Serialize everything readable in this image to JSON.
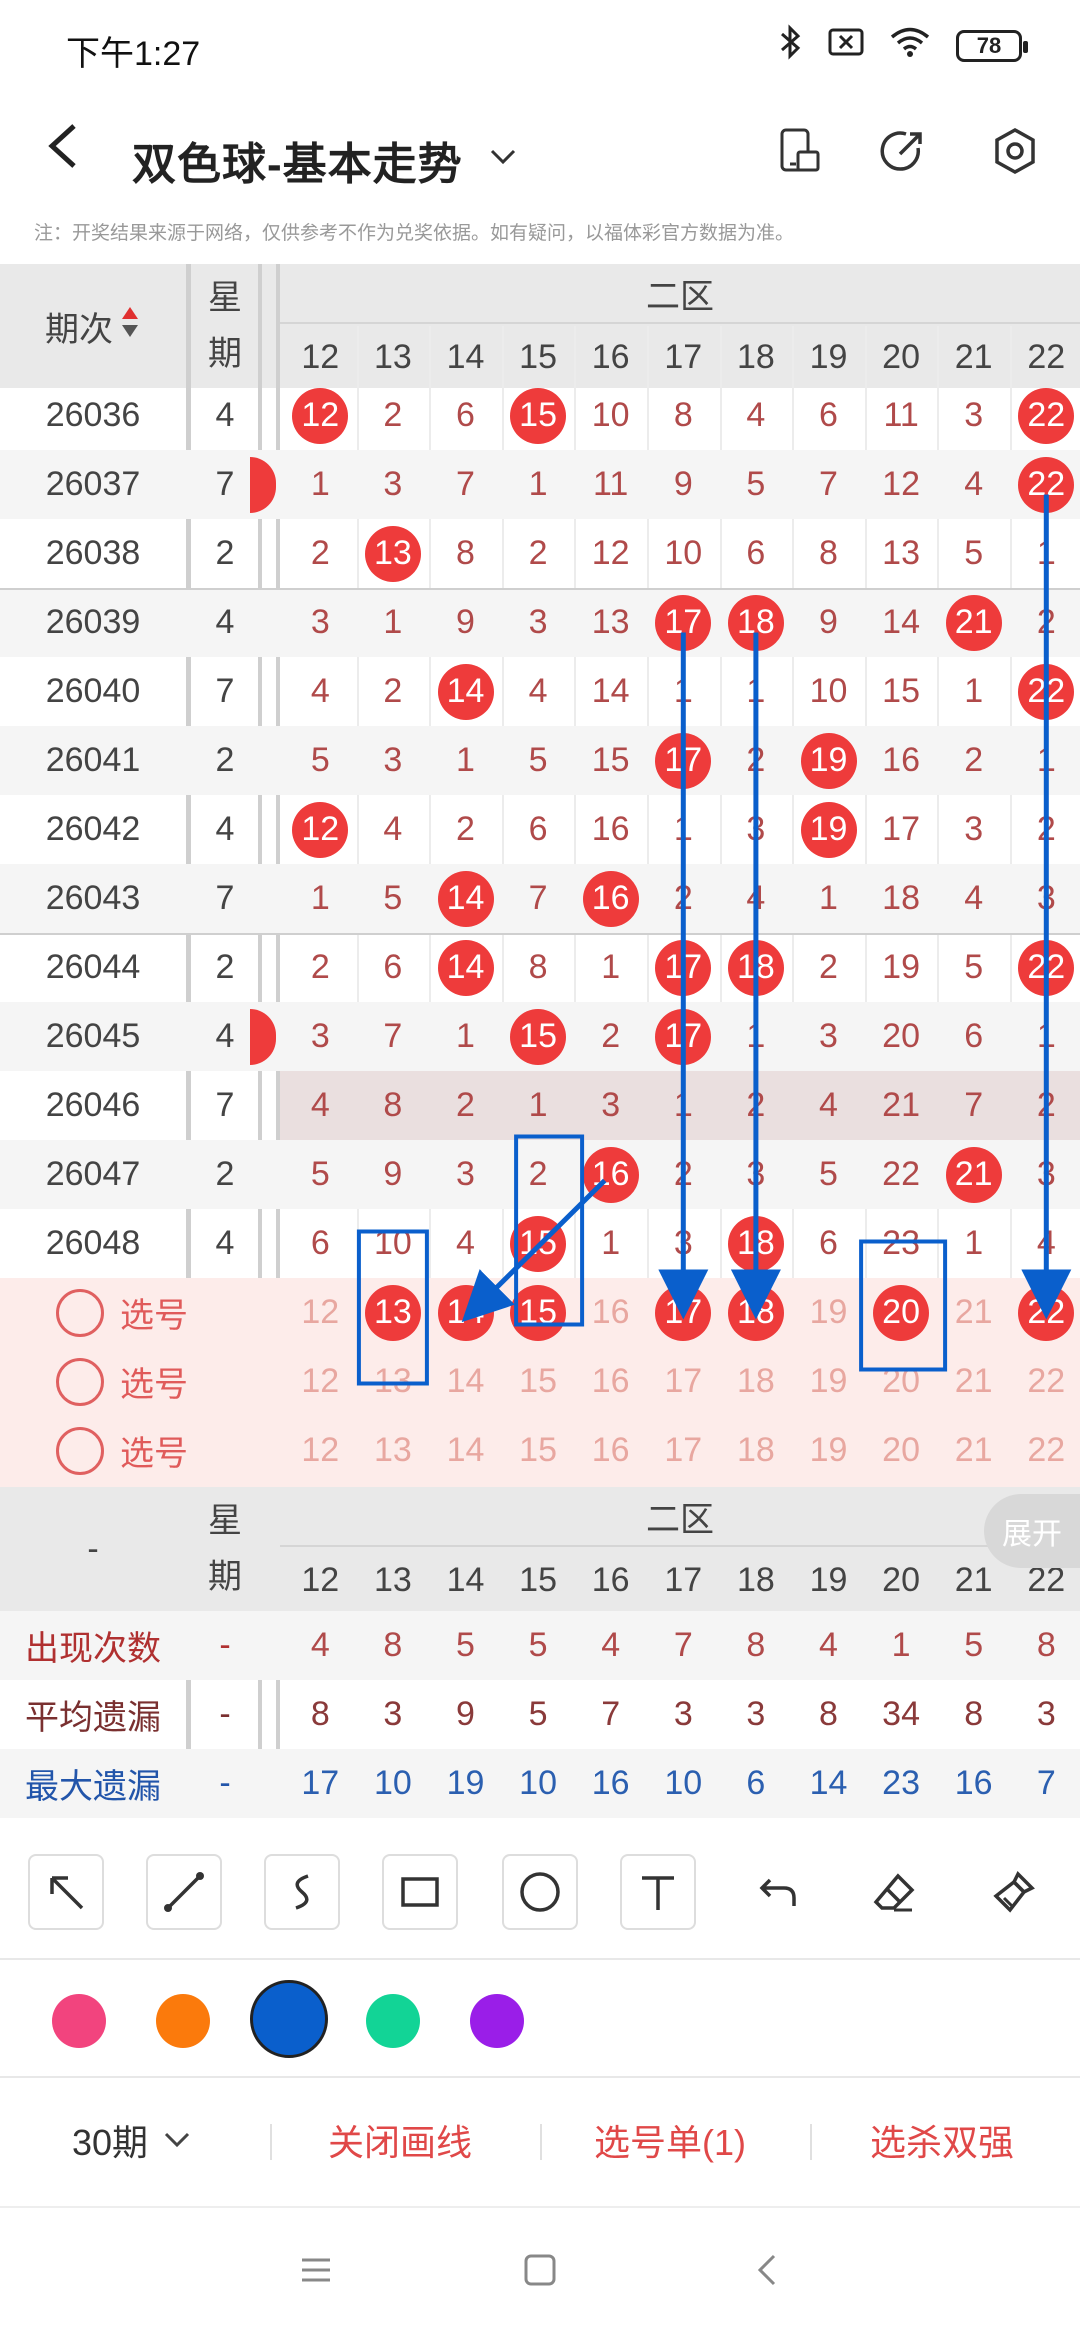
{
  "status": {
    "time": "下午1:27",
    "battery": "78"
  },
  "nav": {
    "title": "双色球-基本走势",
    "back_icon": "chevron-left-icon",
    "drop_icon": "chevron-down-icon"
  },
  "notice": "注：开奖结果来源于网络，仅供参考不作为兑奖依据。如有疑问，以福体彩官方数据为准。",
  "table": {
    "issue_header": "期次",
    "week_header": "星期",
    "zone_label": "二区",
    "columns": [
      "12",
      "13",
      "14",
      "15",
      "16",
      "17",
      "18",
      "19",
      "20",
      "21",
      "22"
    ],
    "rows": [
      {
        "issue": "26036",
        "week": "4",
        "cells": [
          "12",
          "2",
          "6",
          "15",
          "10",
          "8",
          "4",
          "6",
          "11",
          "3",
          "22"
        ],
        "hits": [
          0,
          3,
          10
        ]
      },
      {
        "issue": "26037",
        "week": "7",
        "cells": [
          "1",
          "3",
          "7",
          "1",
          "11",
          "9",
          "5",
          "7",
          "12",
          "4",
          "22"
        ],
        "hits": [
          10
        ]
      },
      {
        "issue": "26038",
        "week": "2",
        "cells": [
          "2",
          "13",
          "8",
          "2",
          "12",
          "10",
          "6",
          "8",
          "13",
          "5",
          "1"
        ],
        "hits": [
          1
        ]
      },
      {
        "issue": "26039",
        "week": "4",
        "cells": [
          "3",
          "1",
          "9",
          "3",
          "13",
          "17",
          "18",
          "9",
          "14",
          "21",
          "2"
        ],
        "hits": [
          5,
          6,
          9
        ]
      },
      {
        "issue": "26040",
        "week": "7",
        "cells": [
          "4",
          "2",
          "14",
          "4",
          "14",
          "1",
          "1",
          "10",
          "15",
          "1",
          "22"
        ],
        "hits": [
          2,
          10
        ]
      },
      {
        "issue": "26041",
        "week": "2",
        "cells": [
          "5",
          "3",
          "1",
          "5",
          "15",
          "17",
          "2",
          "19",
          "16",
          "2",
          "1"
        ],
        "hits": [
          5,
          7
        ]
      },
      {
        "issue": "26042",
        "week": "4",
        "cells": [
          "12",
          "4",
          "2",
          "6",
          "16",
          "1",
          "3",
          "19",
          "17",
          "3",
          "2"
        ],
        "hits": [
          0,
          7
        ]
      },
      {
        "issue": "26043",
        "week": "7",
        "cells": [
          "1",
          "5",
          "14",
          "7",
          "16",
          "2",
          "4",
          "1",
          "18",
          "4",
          "3"
        ],
        "hits": [
          2,
          4
        ]
      },
      {
        "issue": "26044",
        "week": "2",
        "cells": [
          "2",
          "6",
          "14",
          "8",
          "1",
          "17",
          "18",
          "2",
          "19",
          "5",
          "22"
        ],
        "hits": [
          2,
          5,
          6,
          10
        ]
      },
      {
        "issue": "26045",
        "week": "4",
        "cells": [
          "3",
          "7",
          "1",
          "15",
          "2",
          "17",
          "1",
          "3",
          "20",
          "6",
          "1"
        ],
        "hits": [
          3,
          5
        ]
      },
      {
        "issue": "26046",
        "week": "7",
        "cells": [
          "4",
          "8",
          "2",
          "1",
          "3",
          "1",
          "2",
          "4",
          "21",
          "7",
          "2"
        ],
        "hits": []
      },
      {
        "issue": "26047",
        "week": "2",
        "cells": [
          "5",
          "9",
          "3",
          "2",
          "16",
          "2",
          "3",
          "5",
          "22",
          "21",
          "3"
        ],
        "hits": [
          4,
          9
        ]
      },
      {
        "issue": "26048",
        "week": "4",
        "cells": [
          "6",
          "10",
          "4",
          "15",
          "1",
          "3",
          "18",
          "6",
          "23",
          "1",
          "4"
        ],
        "hits": [
          3,
          6
        ]
      }
    ],
    "pick_label": "选号",
    "pick_rows": [
      {
        "hits": [
          1,
          2,
          3,
          5,
          6,
          8,
          10
        ]
      },
      {
        "hits": []
      },
      {
        "hits": []
      }
    ],
    "stats_dash": "-",
    "stats": [
      {
        "label": "出现次数",
        "color": "#b03030",
        "week": "-",
        "values": [
          "4",
          "8",
          "5",
          "5",
          "4",
          "7",
          "8",
          "4",
          "1",
          "5",
          "8"
        ],
        "valcolor": "#b04a4a"
      },
      {
        "label": "平均遗漏",
        "color": "#7a3030",
        "week": "-",
        "values": [
          "8",
          "3",
          "9",
          "5",
          "7",
          "3",
          "3",
          "8",
          "34",
          "8",
          "3"
        ],
        "valcolor": "#8a3a3a"
      },
      {
        "label": "最大遗漏",
        "color": "#2255aa",
        "week": "-",
        "values": [
          "17",
          "10",
          "19",
          "10",
          "16",
          "10",
          "6",
          "14",
          "23",
          "16",
          "7"
        ],
        "valcolor": "#2b5fb0"
      }
    ],
    "expand_label": "展开"
  },
  "tools": [
    "arrow-tool-icon",
    "line-tool-icon",
    "curve-tool-icon",
    "rect-tool-icon",
    "circle-tool-icon",
    "text-tool-icon",
    "undo-icon",
    "eraser-icon",
    "clear-brush-icon"
  ],
  "colors": [
    "#f2447e",
    "#fb7a0c",
    "#0a5fcc",
    "#12d496",
    "#9a1ee8"
  ],
  "bottom": {
    "period": "30期",
    "close": "关闭画线",
    "picks": "选号单(1)",
    "kill": "选杀双强"
  },
  "sysnav": [
    "menu-icon",
    "home-icon",
    "back-icon"
  ]
}
